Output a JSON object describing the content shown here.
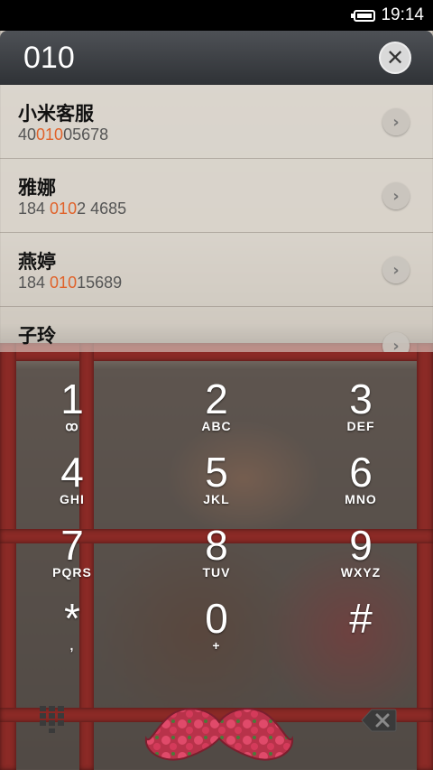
{
  "status": {
    "time": "19:14",
    "battery_icon": "battery-icon"
  },
  "search": {
    "query": "010",
    "clear_icon": "close-icon"
  },
  "results": [
    {
      "name": "小米客服",
      "pre": "40",
      "hl": "010",
      "post": "05678"
    },
    {
      "name": "雅娜",
      "pre": "184 ",
      "hl": "010",
      "post": "2 4685"
    },
    {
      "name": "燕婷",
      "pre": "184 ",
      "hl": "010",
      "post": "15689"
    },
    {
      "name": "子玲",
      "pre": "",
      "hl": "",
      "post": ""
    }
  ],
  "keys": [
    {
      "digit": "1",
      "letters": "ꝏ"
    },
    {
      "digit": "2",
      "letters": "ABC"
    },
    {
      "digit": "3",
      "letters": "DEF"
    },
    {
      "digit": "4",
      "letters": "GHI"
    },
    {
      "digit": "5",
      "letters": "JKL"
    },
    {
      "digit": "6",
      "letters": "MNO"
    },
    {
      "digit": "7",
      "letters": "PQRS"
    },
    {
      "digit": "8",
      "letters": "TUV"
    },
    {
      "digit": "9",
      "letters": "WXYZ"
    },
    {
      "digit": "*",
      "letters": ","
    },
    {
      "digit": "0",
      "letters": "+"
    },
    {
      "digit": "#",
      "letters": ""
    }
  ],
  "highlight_color": "#e0622a",
  "bottom": {
    "left_icon": "dialpad-icon",
    "center_icon": "mustache-call-icon",
    "right_icon": "backspace-icon"
  }
}
